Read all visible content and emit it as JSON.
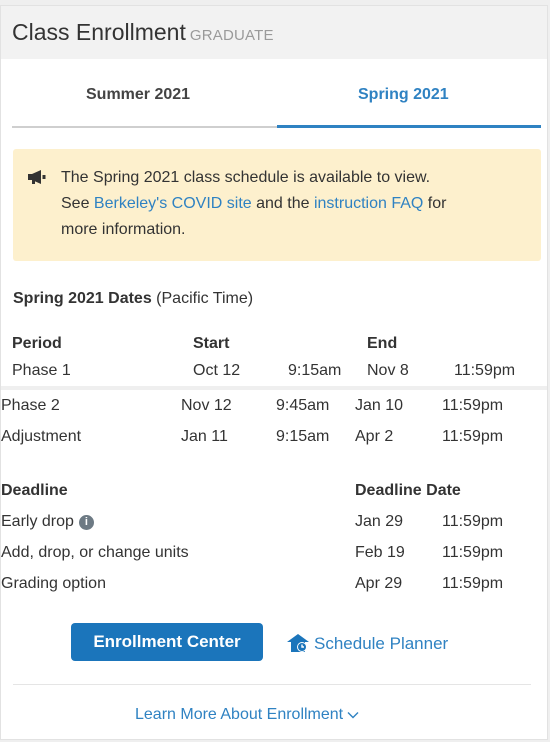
{
  "header": {
    "title": "Class Enrollment",
    "subtitle": "GRADUATE"
  },
  "tabs": [
    {
      "label": "Summer 2021",
      "active": false
    },
    {
      "label": "Spring 2021",
      "active": true
    }
  ],
  "notice": {
    "icon": "megaphone-icon",
    "line1": "The Spring 2021 class schedule is available to view.",
    "see": "See ",
    "link1": "Berkeley's COVID site",
    "and": " and the ",
    "link2": "instruction FAQ",
    "for": " for",
    "line3": "more information."
  },
  "dates": {
    "title_bold": "Spring 2021 Dates",
    "title_note": " (Pacific Time)",
    "headers": {
      "period": "Period",
      "start": "Start",
      "end": "End"
    },
    "rows": [
      {
        "period": "Phase 1",
        "start_date": "Oct 12",
        "start_time": "9:15am",
        "end_date": "Nov 8",
        "end_time": "11:59pm"
      },
      {
        "period": "Phase 2",
        "start_date": "Nov 12",
        "start_time": "9:45am",
        "end_date": "Jan 10",
        "end_time": "11:59pm"
      },
      {
        "period": "Adjustment",
        "start_date": "Jan 11",
        "start_time": "9:15am",
        "end_date": "Apr 2",
        "end_time": "11:59pm"
      }
    ]
  },
  "deadlines": {
    "headers": {
      "deadline": "Deadline",
      "date": "Deadline Date"
    },
    "rows": [
      {
        "name": "Early drop",
        "info_icon": "info-icon",
        "date": "Jan 29",
        "time": "11:59pm"
      },
      {
        "name": "Add, drop, or change units",
        "date": "Feb 19",
        "time": "11:59pm"
      },
      {
        "name": "Grading option",
        "date": "Apr 29",
        "time": "11:59pm"
      }
    ]
  },
  "actions": {
    "enrollment_center": "Enrollment Center",
    "schedule_planner": "Schedule Planner",
    "learn_more": "Learn More About Enrollment"
  },
  "colors": {
    "accent": "#2f82c2",
    "button": "#1b75bb",
    "notice_bg": "#fdf0cd"
  }
}
